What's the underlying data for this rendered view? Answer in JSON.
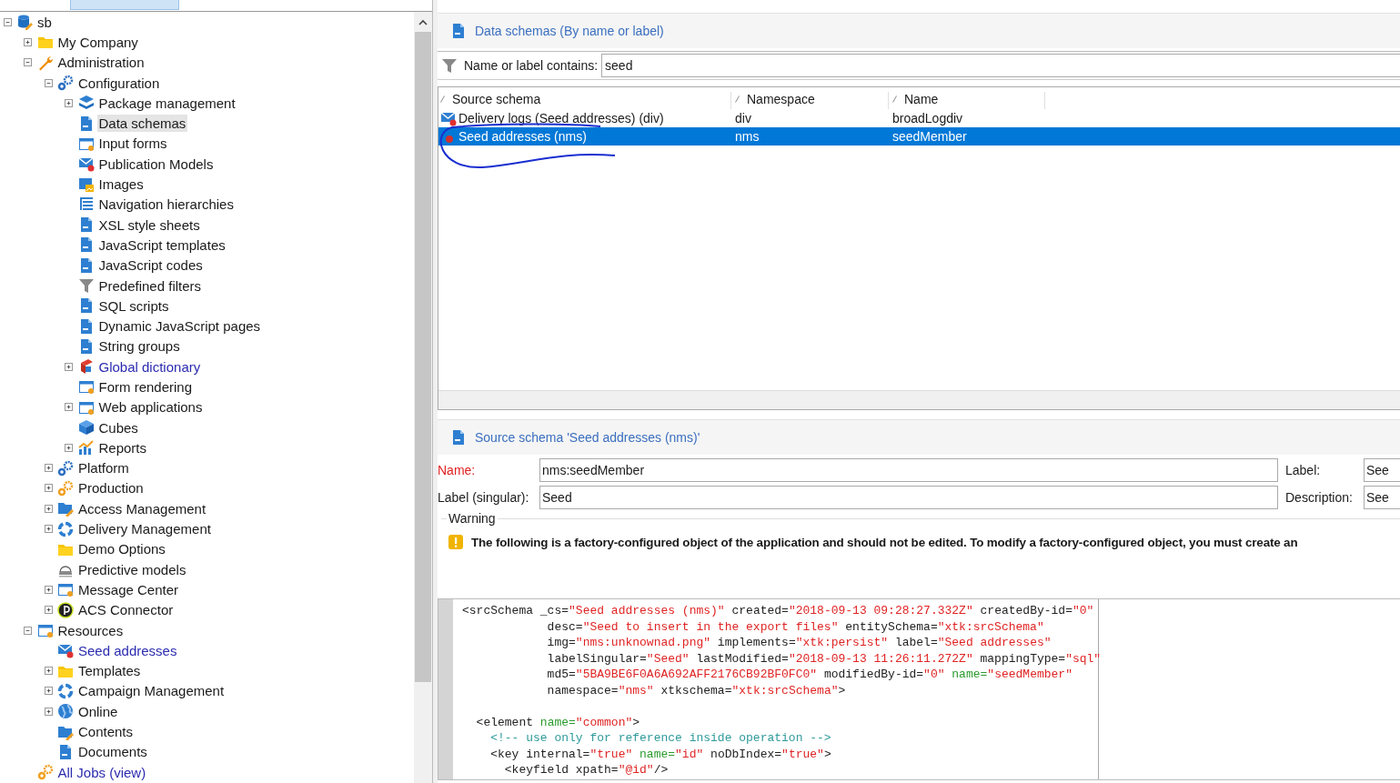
{
  "tree": [
    {
      "label": "sb",
      "kind": "database",
      "expanded": true,
      "selected": false,
      "children": [
        {
          "label": "My Company",
          "kind": "folder",
          "expanded": false,
          "selected": false
        },
        {
          "label": "Administration",
          "kind": "wrench",
          "expanded": true,
          "selected": false,
          "children": [
            {
              "label": "Configuration",
              "kind": "gears",
              "expanded": true,
              "selected": false,
              "children": [
                {
                  "label": "Package management",
                  "kind": "layers",
                  "expanded": false,
                  "selected": false
                },
                {
                  "label": "Data schemas",
                  "kind": "doc",
                  "selected": true
                },
                {
                  "label": "Input forms",
                  "kind": "window",
                  "selected": false
                },
                {
                  "label": "Publication Models",
                  "kind": "envelope",
                  "selected": false
                },
                {
                  "label": "Images",
                  "kind": "images",
                  "selected": false
                },
                {
                  "label": "Navigation hierarchies",
                  "kind": "list",
                  "selected": false
                },
                {
                  "label": "XSL style sheets",
                  "kind": "doc",
                  "selected": false
                },
                {
                  "label": "JavaScript templates",
                  "kind": "doc",
                  "selected": false
                },
                {
                  "label": "JavaScript codes",
                  "kind": "doc",
                  "selected": false
                },
                {
                  "label": "Predefined filters",
                  "kind": "filter",
                  "selected": false
                },
                {
                  "label": "SQL scripts",
                  "kind": "doc",
                  "selected": false
                },
                {
                  "label": "Dynamic JavaScript pages",
                  "kind": "doc",
                  "selected": false
                },
                {
                  "label": "String groups",
                  "kind": "doc",
                  "selected": false
                },
                {
                  "label": "Global dictionary",
                  "kind": "book",
                  "expanded": false,
                  "selected": false,
                  "link": true
                },
                {
                  "label": "Form rendering",
                  "kind": "window",
                  "selected": false
                },
                {
                  "label": "Web applications",
                  "kind": "window",
                  "expanded": false,
                  "selected": false
                },
                {
                  "label": "Cubes",
                  "kind": "cube",
                  "selected": false
                },
                {
                  "label": "Reports",
                  "kind": "chart",
                  "expanded": false,
                  "selected": false
                }
              ]
            },
            {
              "label": "Platform",
              "kind": "gears",
              "expanded": false,
              "selected": false
            },
            {
              "label": "Production",
              "kind": "cogs",
              "expanded": false,
              "selected": false
            },
            {
              "label": "Access Management",
              "kind": "bluefolder",
              "expanded": false,
              "selected": false
            },
            {
              "label": "Delivery Management",
              "kind": "ring",
              "expanded": false,
              "selected": false
            },
            {
              "label": "Demo Options",
              "kind": "folder",
              "selected": false
            },
            {
              "label": "Predictive models",
              "kind": "dome",
              "selected": false
            },
            {
              "label": "Message Center",
              "kind": "window",
              "expanded": false,
              "selected": false
            },
            {
              "label": "ACS Connector",
              "kind": "disc",
              "expanded": false,
              "selected": false
            }
          ]
        },
        {
          "label": "Resources",
          "kind": "window",
          "expanded": true,
          "selected": false,
          "children": [
            {
              "label": "Seed addresses",
              "kind": "envelope",
              "selected": false,
              "link": true
            },
            {
              "label": "Templates",
              "kind": "folder",
              "expanded": false,
              "selected": false
            },
            {
              "label": "Campaign Management",
              "kind": "ring",
              "expanded": false,
              "selected": false
            },
            {
              "label": "Online",
              "kind": "globe",
              "expanded": false,
              "selected": false
            },
            {
              "label": "Contents",
              "kind": "bluefolder",
              "selected": false
            },
            {
              "label": "Documents",
              "kind": "doc",
              "selected": false
            }
          ]
        },
        {
          "label": "All Jobs (view)",
          "kind": "cogs",
          "selected": false,
          "link": true
        }
      ]
    }
  ],
  "list_panel": {
    "title": "Data schemas (By name or label)",
    "filter_label": "Name or label contains:",
    "filter_value": "seed",
    "columns": [
      "Source schema",
      "Namespace",
      "Name"
    ],
    "rows": [
      {
        "kind": "envelope",
        "cells": [
          "Delivery logs (Seed addresses) (div)",
          "div",
          "broadLogdiv"
        ],
        "selected": false
      },
      {
        "kind": "error",
        "cells": [
          "Seed addresses (nms)",
          "nms",
          "seedMember"
        ],
        "selected": true
      }
    ]
  },
  "detail_panel": {
    "title": "Source schema 'Seed addresses (nms)'",
    "fields": [
      {
        "label": "Name:",
        "value": "nms:seedMember",
        "required": true,
        "side_label": "Label:",
        "side_value": "See"
      },
      {
        "label": "Label (singular):",
        "value": "Seed",
        "required": false,
        "side_label": "Description:",
        "side_value": "See"
      }
    ],
    "warning": {
      "legend": "Warning",
      "text": "The following is a factory-configured object of the application and should not be edited. To modify a factory-configured object, you must create an"
    },
    "code": [
      [
        [
          {
            "kind": "tag",
            "text": "<srcSchema _cs="
          },
          {
            "kind": "value",
            "text": "\"Seed addresses (nms)\""
          },
          {
            "kind": "tag",
            "text": " created="
          },
          {
            "kind": "value",
            "text": "\"2018-09-13 09:28:27.332Z\""
          },
          {
            "kind": "tag",
            "text": " createdBy-id="
          },
          {
            "kind": "value",
            "text": "\"0\""
          }
        ],
        [
          {
            "kind": "tag",
            "text": "            desc="
          },
          {
            "kind": "value",
            "text": "\"Seed to insert in the export files\""
          },
          {
            "kind": "tag",
            "text": " entitySchema="
          },
          {
            "kind": "value",
            "text": "\"xtk:srcSchema\""
          }
        ],
        [
          {
            "kind": "tag",
            "text": "            img="
          },
          {
            "kind": "value",
            "text": "\"nms:unknownad.png\""
          },
          {
            "kind": "tag",
            "text": " implements="
          },
          {
            "kind": "value",
            "text": "\"xtk:persist\""
          },
          {
            "kind": "tag",
            "text": " label="
          },
          {
            "kind": "value",
            "text": "\"Seed addresses\""
          }
        ],
        [
          {
            "kind": "tag",
            "text": "            labelSingular="
          },
          {
            "kind": "value",
            "text": "\"Seed\""
          },
          {
            "kind": "tag",
            "text": " lastModified="
          },
          {
            "kind": "value",
            "text": "\"2018-09-13 11:26:11.272Z\""
          },
          {
            "kind": "tag",
            "text": " mappingType="
          },
          {
            "kind": "value",
            "text": "\"sql\""
          }
        ],
        [
          {
            "kind": "tag",
            "text": "            md5="
          },
          {
            "kind": "value",
            "text": "\"5BA9BE6F0A6A692AFF2176CB92BF0FC0\""
          },
          {
            "kind": "tag",
            "text": " modifiedBy-id="
          },
          {
            "kind": "value",
            "text": "\"0\""
          },
          {
            "kind": "key",
            "text": " name="
          },
          {
            "kind": "value",
            "text": "\"seedMember\""
          }
        ],
        [
          {
            "kind": "tag",
            "text": "            namespace="
          },
          {
            "kind": "value",
            "text": "\"nms\""
          },
          {
            "kind": "tag",
            "text": " xtkschema="
          },
          {
            "kind": "value",
            "text": "\"xtk:srcSchema\""
          },
          {
            "kind": "tag",
            "text": ">"
          }
        ]
      ],
      [
        [
          {
            "kind": "tag",
            "text": "  <element "
          },
          {
            "kind": "key",
            "text": "name="
          },
          {
            "kind": "value",
            "text": "\"common\""
          },
          {
            "kind": "tag",
            "text": ">"
          }
        ],
        [
          {
            "kind": "comment",
            "text": "    <!-- use only for reference inside operation -->"
          }
        ],
        [
          {
            "kind": "tag",
            "text": "    <key internal="
          },
          {
            "kind": "value",
            "text": "\"true\""
          },
          {
            "kind": "key",
            "text": " name="
          },
          {
            "kind": "value",
            "text": "\"id\""
          },
          {
            "kind": "tag",
            "text": " noDbIndex="
          },
          {
            "kind": "value",
            "text": "\"true\""
          },
          {
            "kind": "tag",
            "text": ">"
          }
        ],
        [
          {
            "kind": "tag",
            "text": "      <keyfield xpath="
          },
          {
            "kind": "value",
            "text": "\"@id\""
          },
          {
            "kind": "tag",
            "text": "/>"
          }
        ]
      ]
    ]
  }
}
